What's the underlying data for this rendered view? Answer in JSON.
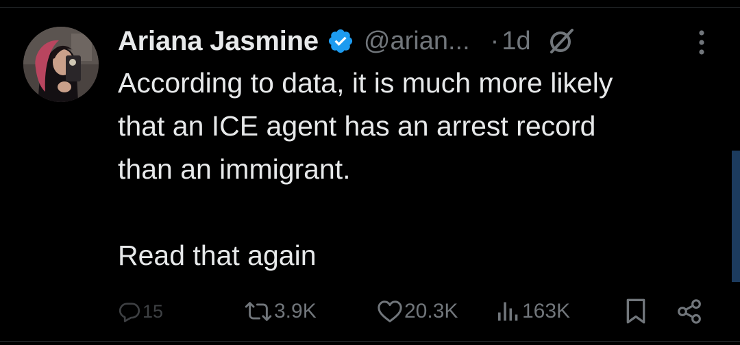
{
  "tweet": {
    "author": {
      "display_name": "Ariana Jasmine",
      "handle": "@arian...",
      "verified": true,
      "avatar_icon": "profile-photo"
    },
    "dot": "·",
    "timestamp": "1d",
    "text_lines": [
      "According to data, it is much more likely",
      "that an ICE agent has an arrest record",
      "than an immigrant.",
      "",
      "Read that again"
    ],
    "actions": {
      "replies": "15",
      "retweets": "3.9K",
      "likes": "20.3K",
      "views": "163K"
    }
  },
  "colors": {
    "background": "#000000",
    "text_primary": "#e7e9ea",
    "text_secondary": "#71767b",
    "verified_badge": "#1d9bf0",
    "divider": "#2f3336",
    "scroll_indicator": "#1c3b5e"
  }
}
